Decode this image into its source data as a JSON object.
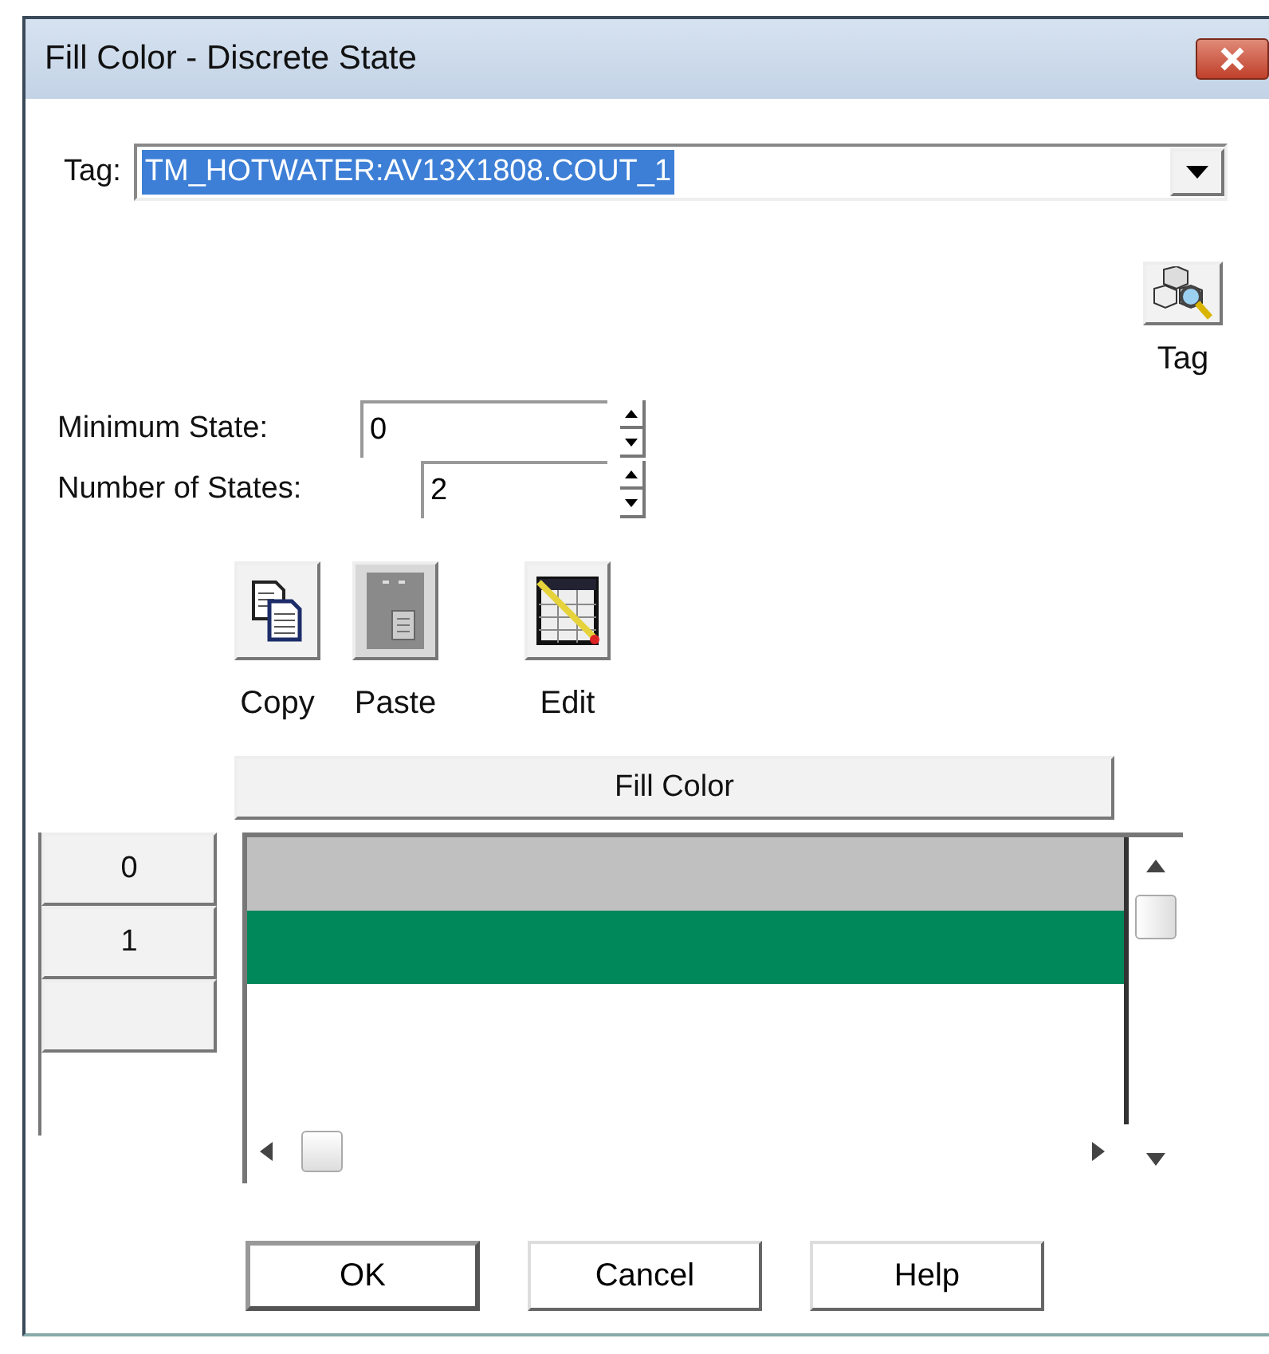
{
  "window": {
    "title": "Fill Color - Discrete State"
  },
  "tag": {
    "label": "Tag:",
    "value": "TM_HOTWATER:AV13X1808.COUT_1",
    "text_selected": true,
    "browse_label": "Tag"
  },
  "fields": [
    {
      "label": "Minimum State:",
      "value": "0"
    },
    {
      "label": "Number of States:",
      "value": "2"
    }
  ],
  "tools": [
    {
      "kind": "copy",
      "label": "Copy"
    },
    {
      "kind": "paste",
      "label": "Paste"
    },
    {
      "kind": "edit",
      "label": "Edit"
    }
  ],
  "grid": {
    "column": "Fill Color",
    "rows": [
      {
        "state": "0",
        "color": "#c0c0c0"
      },
      {
        "state": "1",
        "color": "#00875a"
      }
    ]
  },
  "buttons": [
    {
      "label": "OK",
      "default": true
    },
    {
      "label": "Cancel",
      "default": false
    },
    {
      "label": "Help",
      "default": false
    }
  ]
}
